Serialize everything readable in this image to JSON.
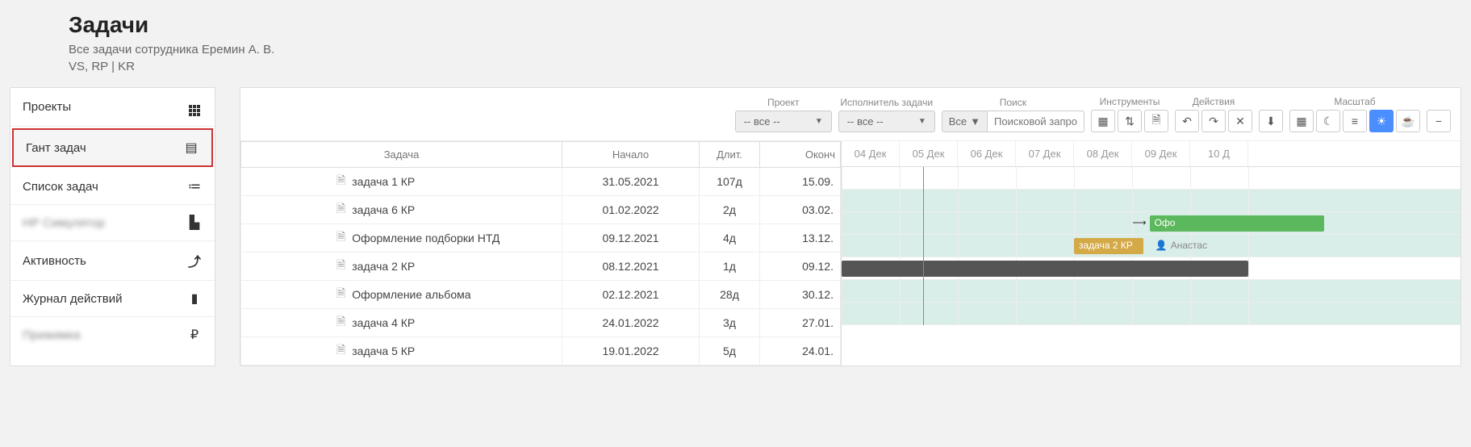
{
  "header": {
    "title": "Задачи",
    "subtitle1": "Все задачи сотрудника Еремин А. В.",
    "subtitle2": "VS, RP | KR"
  },
  "sidebar": {
    "items": [
      {
        "label": "Проекты",
        "icon": "grid"
      },
      {
        "label": "Гант задач",
        "icon": "list-box",
        "highlight": true
      },
      {
        "label": "Список задач",
        "icon": "checklist"
      },
      {
        "label": "НР Симулятор",
        "icon": "bar-chart",
        "blurred": true
      },
      {
        "label": "Активность",
        "icon": "line-chart"
      },
      {
        "label": "Журнал действий",
        "icon": "book"
      },
      {
        "label": "Прижимка",
        "icon": "ruble",
        "blurred": true
      }
    ]
  },
  "toolbar": {
    "project": {
      "label": "Проект",
      "value": "-- все --"
    },
    "assignee": {
      "label": "Исполнитель задачи",
      "value": "-- все --"
    },
    "search": {
      "label": "Поиск",
      "all": "Все",
      "placeholder": "Поисковой запрос..."
    },
    "tools": {
      "label": "Инструменты"
    },
    "actions": {
      "label": "Действия"
    },
    "scale": {
      "label": "Масштаб"
    }
  },
  "table": {
    "headers": {
      "task": "Задача",
      "start": "Начало",
      "duration": "Длит.",
      "end": "Оконч"
    },
    "rows": [
      {
        "task": "задача 1 КР",
        "start": "31.05.2021",
        "dur": "107д",
        "end": "15.09."
      },
      {
        "task": "задача 6 КР",
        "start": "01.02.2022",
        "dur": "2д",
        "end": "03.02."
      },
      {
        "task": "Оформление подборки НТД",
        "start": "09.12.2021",
        "dur": "4д",
        "end": "13.12."
      },
      {
        "task": "задача 2 КР",
        "start": "08.12.2021",
        "dur": "1д",
        "end": "09.12."
      },
      {
        "task": "Оформление альбома",
        "start": "02.12.2021",
        "dur": "28д",
        "end": "30.12."
      },
      {
        "task": "задача 4 КР",
        "start": "24.01.2022",
        "dur": "3д",
        "end": "27.01."
      },
      {
        "task": "задача 5 КР",
        "start": "19.01.2022",
        "dur": "5д",
        "end": "24.01."
      }
    ]
  },
  "gantt": {
    "days": [
      "04 Дек",
      "05 Дек",
      "06 Дек",
      "07 Дек",
      "08 Дек",
      "09 Дек",
      "10 Д"
    ],
    "today_index": 1.4,
    "bars": [
      {
        "row": 2,
        "start": 5.3,
        "width": 3,
        "class": "green",
        "label": "Офо",
        "arrow_at": 5.2
      },
      {
        "row": 3,
        "start": 4.0,
        "width": 1.2,
        "class": "yellow",
        "label": "задача 2 КР",
        "ext_label": "Анастас",
        "ext_at": 5.4
      },
      {
        "row": 4,
        "start": 0,
        "width": 7,
        "class": "dark",
        "label": ""
      }
    ]
  }
}
